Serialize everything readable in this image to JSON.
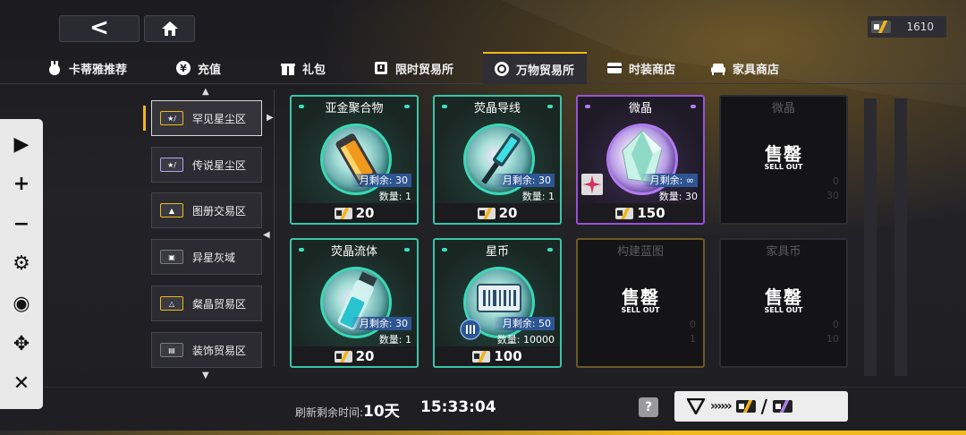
{
  "header": {
    "back_icon": "back-chevron-icon",
    "home_icon": "home-icon",
    "currency_value": "1610",
    "currency_icon": "star-coin-icon"
  },
  "tabs": [
    {
      "label": "卡蒂雅推荐",
      "icon": "rabbit-icon",
      "active": false
    },
    {
      "label": "充值",
      "icon": "yen-icon",
      "active": false
    },
    {
      "label": "礼包",
      "icon": "gift-icon",
      "active": false
    },
    {
      "label": "限时贸易所",
      "icon": "clock-box-icon",
      "active": false
    },
    {
      "label": "万物贸易所",
      "icon": "refresh-icon",
      "active": true
    },
    {
      "label": "时装商店",
      "icon": "wardrobe-icon",
      "active": false
    },
    {
      "label": "家具商店",
      "icon": "sofa-icon",
      "active": false
    }
  ],
  "controls": [
    {
      "icon": "play-icon",
      "glyph": "▶"
    },
    {
      "icon": "plus-icon",
      "glyph": "+"
    },
    {
      "icon": "minus-icon",
      "glyph": "−"
    },
    {
      "icon": "gear-icon",
      "glyph": "⚙"
    },
    {
      "icon": "eye-icon",
      "glyph": "◉"
    },
    {
      "icon": "move-icon",
      "glyph": "✥"
    },
    {
      "icon": "close-icon",
      "glyph": "✕"
    }
  ],
  "categories": [
    {
      "label": "罕见星尘区",
      "active": true
    },
    {
      "label": "传说星尘区",
      "active": false
    },
    {
      "label": "图册交易区",
      "active": false
    },
    {
      "label": "异星灰域",
      "active": false
    },
    {
      "label": "粲晶贸易区",
      "active": false
    },
    {
      "label": "装饰贸易区",
      "active": false
    }
  ],
  "items": [
    {
      "title": "亚金聚合物",
      "monthly": "月剩余: 30",
      "qty": "数量: 1",
      "price": "20",
      "rarity": "teal",
      "art": "amber-canister-icon"
    },
    {
      "title": "荧晶导线",
      "monthly": "月剩余: 30",
      "qty": "数量: 1",
      "price": "20",
      "rarity": "teal",
      "art": "cable-connector-icon"
    },
    {
      "title": "微晶",
      "monthly": "月剩余: ∞",
      "qty": "数量: 30",
      "price": "150",
      "rarity": "purple",
      "art": "crystal-icon"
    },
    {
      "title": "微晶",
      "sold_out": true,
      "stamp": "售罄",
      "stamp_en": "SELL OUT",
      "ghost_monthly": "0",
      "ghost_qty": "30"
    },
    {
      "title": "荧晶流体",
      "monthly": "月剩余: 30",
      "qty": "数量: 1",
      "price": "20",
      "rarity": "teal",
      "art": "fluid-vial-icon"
    },
    {
      "title": "星币",
      "monthly": "月剩余: 50",
      "qty": "数量: 10000",
      "price": "100",
      "rarity": "teal",
      "art": "star-coin-card-icon"
    },
    {
      "title": "构建蓝图",
      "sold_out": true,
      "stamp": "售罄",
      "stamp_en": "SELL OUT",
      "ghost_monthly": "0",
      "ghost_qty": "1"
    },
    {
      "title": "家具币",
      "sold_out": true,
      "stamp": "售罄",
      "stamp_en": "SELL OUT",
      "ghost_monthly": "0",
      "ghost_qty": "10"
    }
  ],
  "footer": {
    "refresh_label": "刷新剩余时间:",
    "refresh_days": "10天",
    "refresh_time": "15:33:04",
    "help": "?",
    "trade_chevrons": "››››››",
    "trade_slash": "/"
  }
}
